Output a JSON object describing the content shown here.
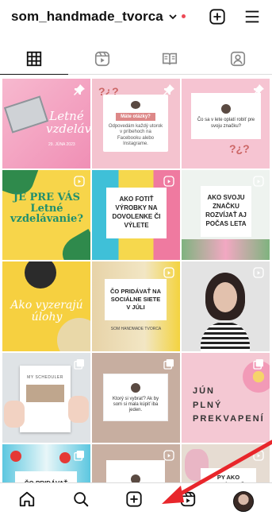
{
  "header": {
    "username": "som_handmade_tvorca"
  },
  "posts": [
    {
      "title": "Letné vzdelávanie",
      "subtitle": "29. JÚNA 2023"
    },
    {
      "top": "Máte otázky?",
      "body": "Odpovedám každý utorok v príbehoch na Facebooku alebo Instagrame."
    },
    {
      "body": "Čo sa v lete oplatí robiť pre svoju značku?"
    },
    {
      "title": "JE PRE VÁS Letné vzdelávanie?"
    },
    {
      "title": "AKO FOTIŤ VÝROBKY NA DOVOLENKE ČI VÝLETE"
    },
    {
      "title": "AKO SVOJU ZNAČKU ROZVÍJAŤ AJ POČAS LETA"
    },
    {
      "title": "Ako vyzerajú úlohy"
    },
    {
      "title": "ČO PRIDÁVAŤ NA SOCIÁLNE SIETE V JÚLI",
      "footer": "SOM HANDMADE TVORCA"
    },
    {
      "title": ""
    },
    {
      "title": "MY SCHEDULER"
    },
    {
      "body": "Ktorý si vybrať? Ak by som si mala kúpiť iba jeden."
    },
    {
      "line1": "JÚN",
      "line2": "PLNÝ",
      "line3": "PREKVAPENÍ"
    },
    {
      "title": "ČO PRIDÁVAŤ"
    },
    {
      "title": ""
    },
    {
      "title": "PY AKO ZVLÁDNUŤ"
    }
  ],
  "colors": {
    "arrow": "#e8262b",
    "pink": "#f58fb6",
    "yellow": "#f7d54a"
  }
}
